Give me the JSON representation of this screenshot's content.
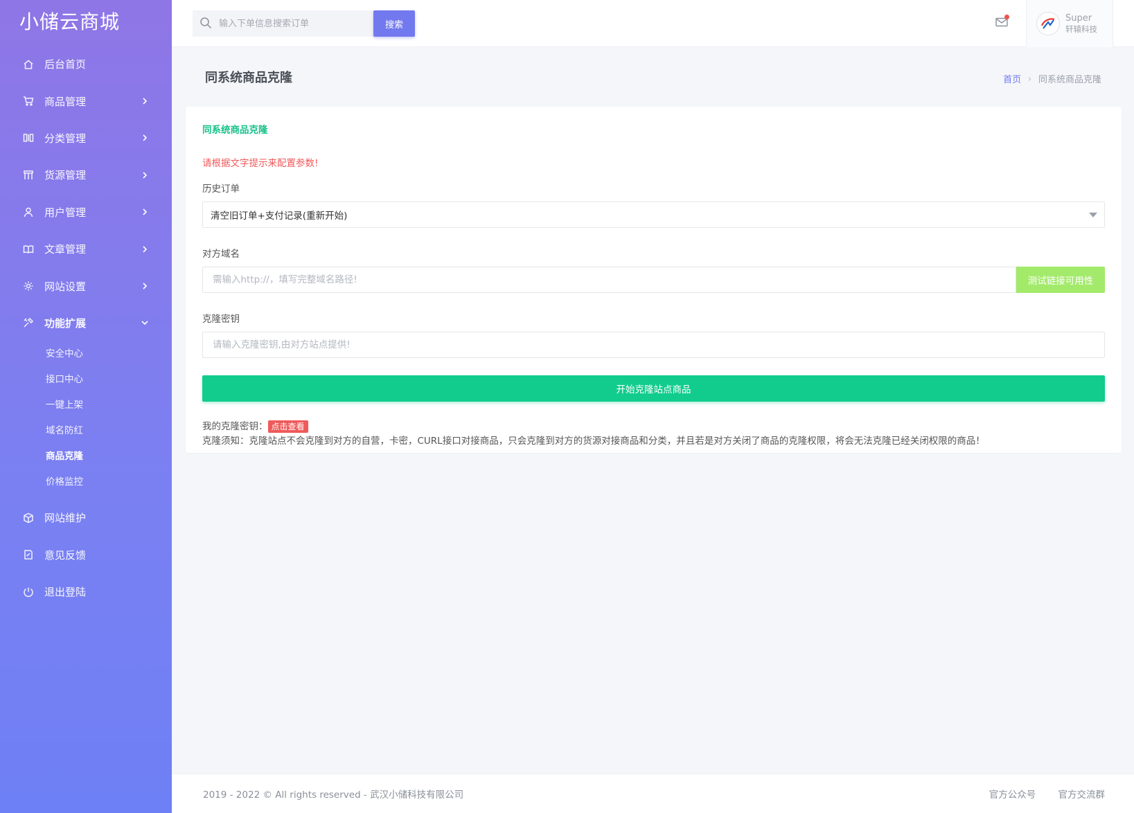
{
  "brand": "小储云商城",
  "sidebar": {
    "items": [
      {
        "label": "后台首页",
        "icon": "home-icon",
        "has_children": false
      },
      {
        "label": "商品管理",
        "icon": "cart-icon",
        "has_children": true
      },
      {
        "label": "分类管理",
        "icon": "columns-icon",
        "has_children": true
      },
      {
        "label": "货源管理",
        "icon": "grid-icon",
        "has_children": true
      },
      {
        "label": "用户管理",
        "icon": "user-icon",
        "has_children": true
      },
      {
        "label": "文章管理",
        "icon": "book-icon",
        "has_children": true
      },
      {
        "label": "网站设置",
        "icon": "gear-icon",
        "has_children": true
      },
      {
        "label": "功能扩展",
        "icon": "tools-icon",
        "has_children": true,
        "open": true
      }
    ],
    "submenu": [
      "安全中心",
      "接口中心",
      "一键上架",
      "域名防红",
      "商品克隆",
      "价格监控"
    ],
    "submenu_active": "商品克隆",
    "bottom_items": [
      {
        "label": "网站维护",
        "icon": "box-icon"
      },
      {
        "label": "意见反馈",
        "icon": "feedback-icon"
      },
      {
        "label": "退出登陆",
        "icon": "power-icon"
      }
    ]
  },
  "header": {
    "search_placeholder": "输入下单信息搜索订单",
    "search_button": "搜索",
    "user_name": "Super",
    "user_company": "轩辕科技"
  },
  "page": {
    "title": "同系统商品克隆",
    "breadcrumb_home": "首页",
    "breadcrumb_current": "同系统商品克隆"
  },
  "card": {
    "title": "同系统商品克隆",
    "hint": "请根据文字提示来配置参数!",
    "history_label": "历史订单",
    "history_selected": "清空旧订单+支付记录(重新开始)",
    "domain_label": "对方域名",
    "domain_placeholder": "需输入http://，填写完整域名路径!",
    "test_button": "测试链接可用性",
    "key_label": "克隆密钥",
    "key_placeholder": "请输入克隆密钥,由对方站点提供!",
    "start_button": "开始克隆站点商品",
    "my_key_label": "我的克隆密钥：",
    "my_key_badge": "点击查看",
    "notice": "克隆须知：克隆站点不会克隆到对方的自营，卡密，CURL接口对接商品，只会克隆到对方的货源对接商品和分类，并且若是对方关闭了商品的克隆权限，将会无法克隆已经关闭权限的商品！"
  },
  "footer": {
    "copyright": "2019 - 2022 © All rights reserved - 武汉小储科技有限公司",
    "link1": "官方公众号",
    "link2": "官方交流群"
  },
  "colors": {
    "sidebar_top": "#8f76e6",
    "sidebar_bottom": "#6e80f5",
    "accent": "#7279ee",
    "success": "#12cc8d",
    "danger": "#f05a5a",
    "test_button": "#a3ea6b"
  }
}
